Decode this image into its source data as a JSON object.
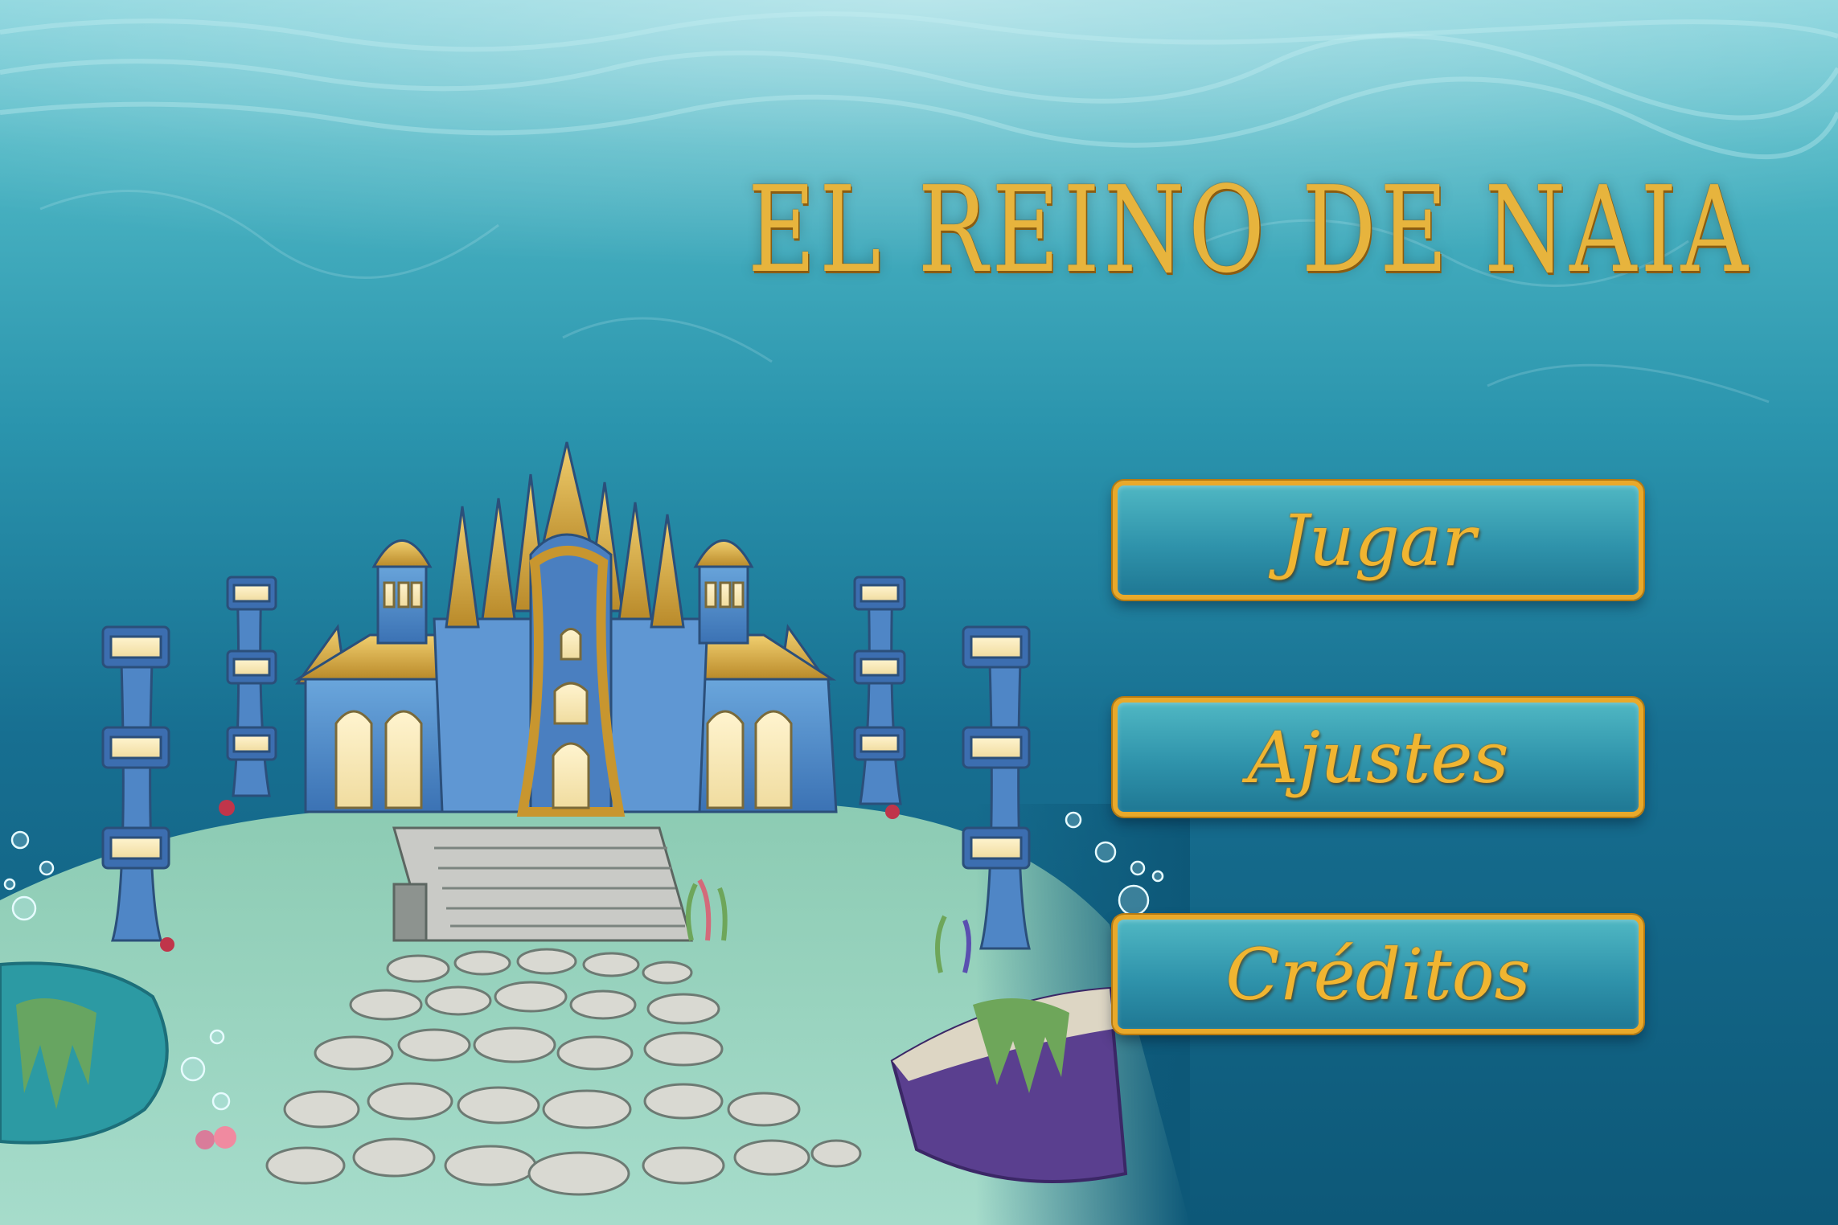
{
  "game": {
    "title": "EL REINO DE NAIA"
  },
  "menu": {
    "play_label": "Jugar",
    "settings_label": "Ajustes",
    "credits_label": "Créditos"
  },
  "colors": {
    "water_top": "#5fc3cf",
    "water_deep": "#0e5a78",
    "gold": "#e7b43d",
    "castle_blue": "#4f86c6",
    "sand_green": "#8fc9b2",
    "button_fill": "#2f93ab"
  },
  "icons": [
    "castle",
    "pillar",
    "bubbles",
    "seaweed",
    "coral",
    "shell"
  ]
}
